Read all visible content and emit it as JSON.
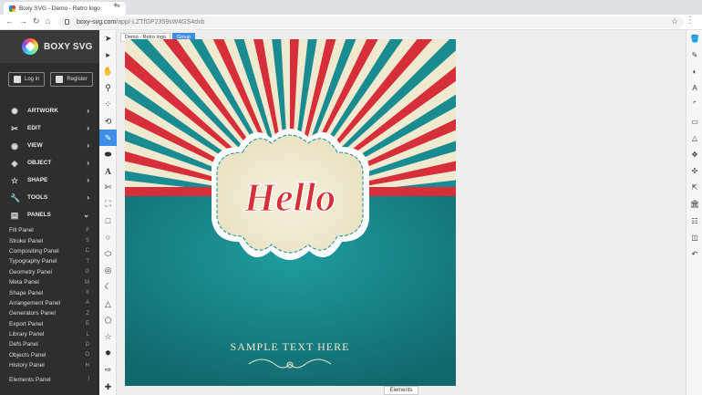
{
  "browser": {
    "tab_title": "Boxy SVG - Demo - Retro logo",
    "tab_close": "×",
    "new_tab": "+",
    "url_host": "boxy-svg.com",
    "url_path": "/app/-LZTfGP2359sW4GS4dxb"
  },
  "app": {
    "name": "BOXY SVG",
    "login": "Log in",
    "register": "Register"
  },
  "menu": [
    {
      "label": "ARTWORK",
      "icon": "artwork-icon"
    },
    {
      "label": "EDIT",
      "icon": "scissors-icon"
    },
    {
      "label": "VIEW",
      "icon": "eye-icon"
    },
    {
      "label": "OBJECT",
      "icon": "object-icon"
    },
    {
      "label": "SHAPE",
      "icon": "star-icon"
    },
    {
      "label": "TOOLS",
      "icon": "wrench-icon"
    },
    {
      "label": "PANELS",
      "icon": "panels-icon"
    }
  ],
  "panels": [
    {
      "label": "Fill Panel",
      "key": "F"
    },
    {
      "label": "Stroke Panel",
      "key": "S"
    },
    {
      "label": "Compositing Panel",
      "key": "C"
    },
    {
      "label": "Typography Panel",
      "key": "T"
    },
    {
      "label": "Geometry Panel",
      "key": "G"
    },
    {
      "label": "Meta Panel",
      "key": "M"
    },
    {
      "label": "Shape Panel",
      "key": "X"
    },
    {
      "label": "Arrangement Panel",
      "key": "A"
    },
    {
      "label": "Generators Panel",
      "key": "Z"
    },
    {
      "label": "Export Panel",
      "key": "E"
    },
    {
      "label": "Library Panel",
      "key": "L"
    },
    {
      "label": "Defs Panel",
      "key": "D"
    },
    {
      "label": "Objects Panel",
      "key": "O"
    },
    {
      "label": "History Panel",
      "key": "H"
    }
  ],
  "elements_panel": {
    "label": "Elements Panel",
    "key": "I"
  },
  "breadcrumb": [
    "Demo - Retro logo",
    "Group"
  ],
  "canvas": {
    "hello_text": "Hello",
    "sample_text": "SAMPLE TEXT HERE",
    "colors": {
      "red": "#d62f3a",
      "teal": "#1a8c91",
      "cream": "#efe9cf"
    }
  },
  "elements_tab": "Elements"
}
